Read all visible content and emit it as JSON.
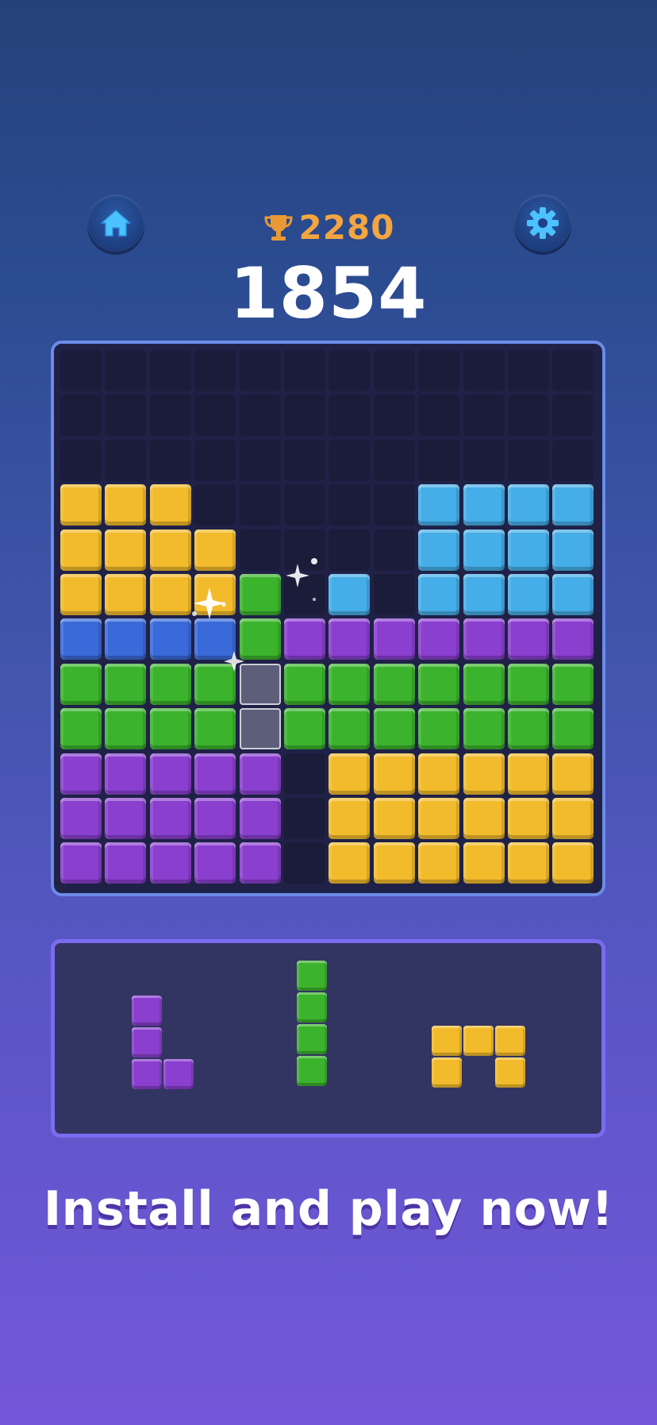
{
  "header": {
    "home_icon": "home-icon",
    "settings_icon": "gear-icon",
    "trophy_icon": "trophy-icon",
    "best_score": "2280",
    "current_score": "1854"
  },
  "colors": {
    "Y": "#f2bb2c",
    "C": "#45ade7",
    "B": "#3a6ad9",
    "G": "#3cb32d",
    "P": "#8a3fcf",
    "empty": "#1b1c3a"
  },
  "board": {
    "columns": 12,
    "rows": 12,
    "grid": [
      "............",
      "............",
      "............",
      "YYY.....CCCC.",
      "YYYY....CCCCC",
      "YYYYG.C.CCCCC",
      "BBBBGPPPPPPPP",
      "GGGG#GGGGGGGG",
      "GGGG#GGGGGGGG",
      "PPPPP.YYYYYY",
      "PPPPP.YYYYYY",
      "PPPPP.YYYYYY"
    ]
  },
  "tray": {
    "pieces": [
      {
        "name": "purple-l-piece",
        "color": "P",
        "cells": [
          [
            0,
            0
          ],
          [
            0,
            1
          ],
          [
            0,
            2
          ],
          [
            1,
            2
          ]
        ]
      },
      {
        "name": "green-i-piece",
        "color": "G",
        "cells": [
          [
            0,
            0
          ],
          [
            0,
            1
          ],
          [
            0,
            2
          ],
          [
            0,
            3
          ]
        ]
      },
      {
        "name": "yellow-arch-piece",
        "color": "Y",
        "cells": [
          [
            0,
            0
          ],
          [
            1,
            0
          ],
          [
            2,
            0
          ],
          [
            0,
            1
          ],
          [
            2,
            1
          ]
        ]
      }
    ]
  },
  "cta": {
    "text": "Install and play now!"
  }
}
